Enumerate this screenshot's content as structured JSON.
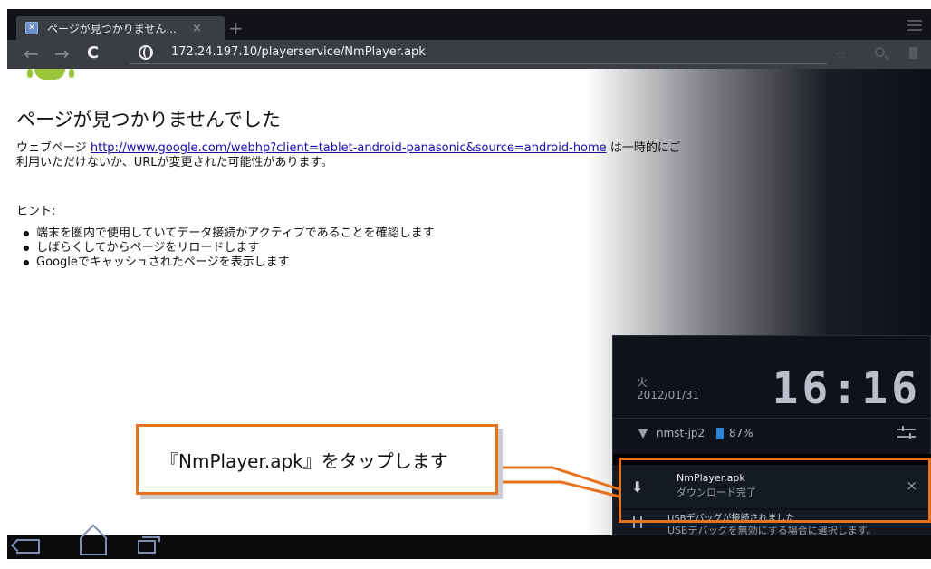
{
  "browser": {
    "tab_title": "ページが見つかりません...",
    "tab_close": "×",
    "new_tab": "+",
    "back_glyph": "←",
    "forward_glyph": "→",
    "reload_glyph": "C",
    "url": "172.24.197.10/playerservice/NmPlayer.apk",
    "star_glyph": "☆"
  },
  "page": {
    "title": "ページが見つかりませんでした",
    "body_prefix": "ウェブページ ",
    "link": "http://www.google.com/webhp?client=tablet-android-panasonic&source=android-home",
    "body_suffix": " は一時的にご利用いただけないか、URLが変更された可能性があります。",
    "hint_label": "ヒント:",
    "tips": [
      "端末を圏内で使用していてデータ接続がアクティブであることを確認します",
      "しばらくしてからページをリロードします",
      "Googleでキャッシュされたページを表示します"
    ]
  },
  "notification_panel": {
    "day": "火",
    "date": "2012/01/31",
    "time": "16:16",
    "ssid": "nmst-jp2",
    "battery": "87%",
    "download": {
      "title": "NmPlayer.apk",
      "status": "ダウンロード完了",
      "close": "×"
    },
    "usb": {
      "title": "USBデバッグが接続されました",
      "detail": "USBデバッグを無効にする場合に選択します。"
    }
  },
  "callout": {
    "text": "『NmPlayer.apk』をタップします"
  },
  "colors": {
    "highlight": "#e8721c",
    "link": "#1a0dab",
    "android_green": "#9ac43a"
  }
}
